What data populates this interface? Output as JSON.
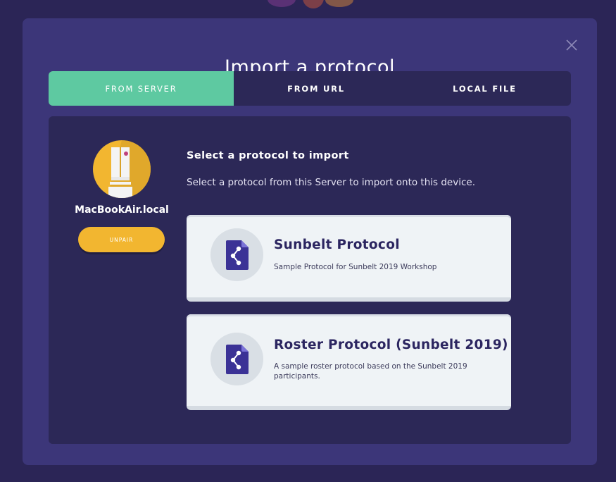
{
  "modal": {
    "title": "Import a protocol"
  },
  "tabs": [
    {
      "label": "FROM SERVER",
      "active": true
    },
    {
      "label": "FROM URL",
      "active": false
    },
    {
      "label": "LOCAL FILE",
      "active": false
    }
  ],
  "server": {
    "name": "MacBookAir.local",
    "unpair_label": "UNPAIR",
    "avatar_icon": "server-icon"
  },
  "section": {
    "heading": "Select a protocol to import",
    "description": "Select a protocol from this Server to import onto this device."
  },
  "protocols": [
    {
      "name": "Sunbelt Protocol",
      "description": "Sample Protocol for Sunbelt 2019 Workshop",
      "icon": "protocol-file-icon"
    },
    {
      "name": "Roster Protocol (Sunbelt 2019)",
      "description": "A sample roster protocol based on the Sunbelt 2019 participants.",
      "icon": "protocol-file-icon"
    }
  ],
  "colors": {
    "accent_tab": "#5ec9a1",
    "unpair_button": "#f2b630",
    "modal_bg": "#3c3679",
    "panel_bg": "#2c2857",
    "card_bg": "#eff3f6",
    "card_title": "#2b2560"
  }
}
